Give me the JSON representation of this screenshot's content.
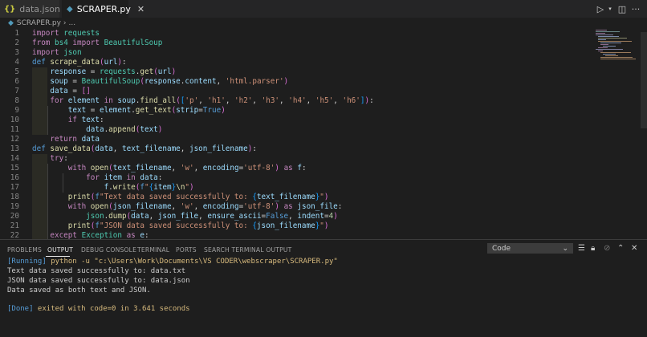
{
  "tabs": [
    {
      "icon": "{}",
      "label": "data.json"
    },
    {
      "icon": "◆",
      "label": "SCRAPER.py",
      "close": "✕"
    }
  ],
  "breadcrumb": {
    "file": "SCRAPER.py",
    "sep": "›",
    "rest": "..."
  },
  "editor": {
    "line_numbers": [
      "1",
      "2",
      "3",
      "4",
      "5",
      "6",
      "7",
      "8",
      "9",
      "10",
      "11",
      "12",
      "13",
      "14",
      "15",
      "16",
      "17",
      "18",
      "19",
      "20",
      "21",
      "22"
    ]
  },
  "panel": {
    "tabs": [
      "PROBLEMS",
      "OUTPUT",
      "DEBUG CONSOLE",
      "TERMINAL",
      "PORTS",
      "SEARCH TERMINAL OUTPUT"
    ],
    "select_value": "Code",
    "output": {
      "running_tag": "[Running]",
      "running_cmd": " python -u \"c:\\Users\\Work\\Documents\\VS CODER\\webscraper\\SCRAPER.py\"",
      "line1": "Text data saved successfully to: data.txt",
      "line2": "JSON data saved successfully to: data.json",
      "line3": "Data saved as both text and JSON.",
      "done_tag": "[Done]",
      "done_text": " exited with code=0 in 3.641 seconds"
    }
  }
}
